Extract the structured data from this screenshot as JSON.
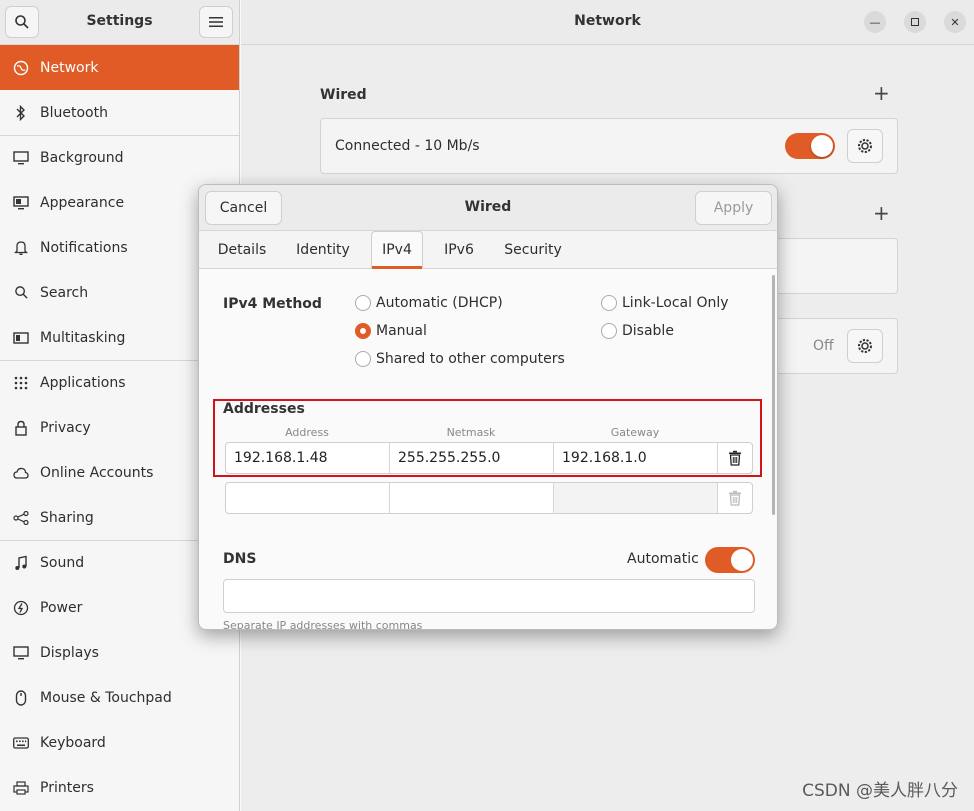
{
  "sidebar_header": {
    "title": "Settings"
  },
  "main_header": {
    "title": "Network"
  },
  "sidebar": {
    "items": [
      {
        "label": "Network"
      },
      {
        "label": "Bluetooth"
      },
      {
        "label": "Background"
      },
      {
        "label": "Appearance"
      },
      {
        "label": "Notifications"
      },
      {
        "label": "Search"
      },
      {
        "label": "Multitasking"
      },
      {
        "label": "Applications"
      },
      {
        "label": "Privacy"
      },
      {
        "label": "Online Accounts"
      },
      {
        "label": "Sharing"
      },
      {
        "label": "Sound"
      },
      {
        "label": "Power"
      },
      {
        "label": "Displays"
      },
      {
        "label": "Mouse & Touchpad"
      },
      {
        "label": "Keyboard"
      },
      {
        "label": "Printers"
      }
    ]
  },
  "main": {
    "wired_title": "Wired",
    "wired_status": "Connected - 10 Mb/s",
    "proxy_status": "Off"
  },
  "dialog": {
    "title": "Wired",
    "cancel": "Cancel",
    "apply": "Apply",
    "tabs": [
      "Details",
      "Identity",
      "IPv4",
      "IPv6",
      "Security"
    ],
    "active_tab": "IPv4",
    "ipv4_method_label": "IPv4 Method",
    "methods": {
      "automatic": "Automatic (DHCP)",
      "link_local": "Link-Local Only",
      "manual": "Manual",
      "disable": "Disable",
      "shared": "Shared to other computers"
    },
    "selected_method": "Manual",
    "addresses_label": "Addresses",
    "columns": [
      "Address",
      "Netmask",
      "Gateway"
    ],
    "rows": [
      {
        "address": "192.168.1.48",
        "netmask": "255.255.255.0",
        "gateway": "192.168.1.0"
      }
    ],
    "dns_label": "DNS",
    "dns_auto_label": "Automatic",
    "dns_hint": "Separate IP addresses with commas"
  },
  "watermark": "CSDN @美人胖八分",
  "colors": {
    "accent": "#e05b25",
    "highlight": "#d3131a"
  }
}
